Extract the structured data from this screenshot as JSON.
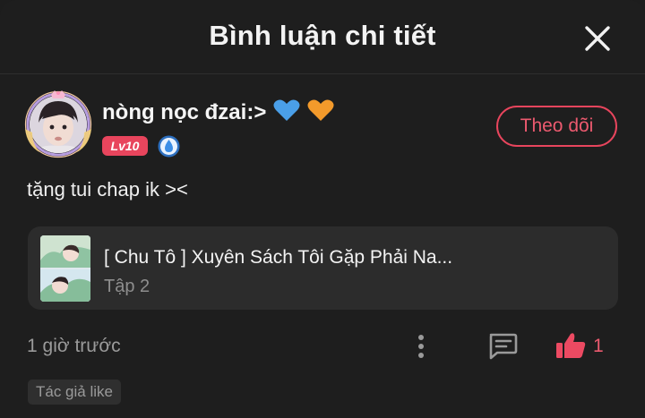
{
  "header": {
    "title": "Bình luận chi tiết"
  },
  "user": {
    "name": "nòng nọc đzai:>",
    "level": "Lv10",
    "hearts": [
      "blue-heart-icon",
      "orange-heart-icon"
    ],
    "follow_label": "Theo dõi"
  },
  "comment": {
    "text": "tặng tui chap ik ><"
  },
  "story_card": {
    "title": "[ Chu Tô ] Xuyên Sách Tôi Gặp Phải Na...",
    "episode": "Tập 2"
  },
  "footer": {
    "time": "1 giờ trước",
    "like_count": "1",
    "author_like": "Tác giả like"
  },
  "colors": {
    "background": "#1e1e1e",
    "accent": "#e8455d",
    "card": "#2c2c2c",
    "muted": "#9a9a9a"
  }
}
